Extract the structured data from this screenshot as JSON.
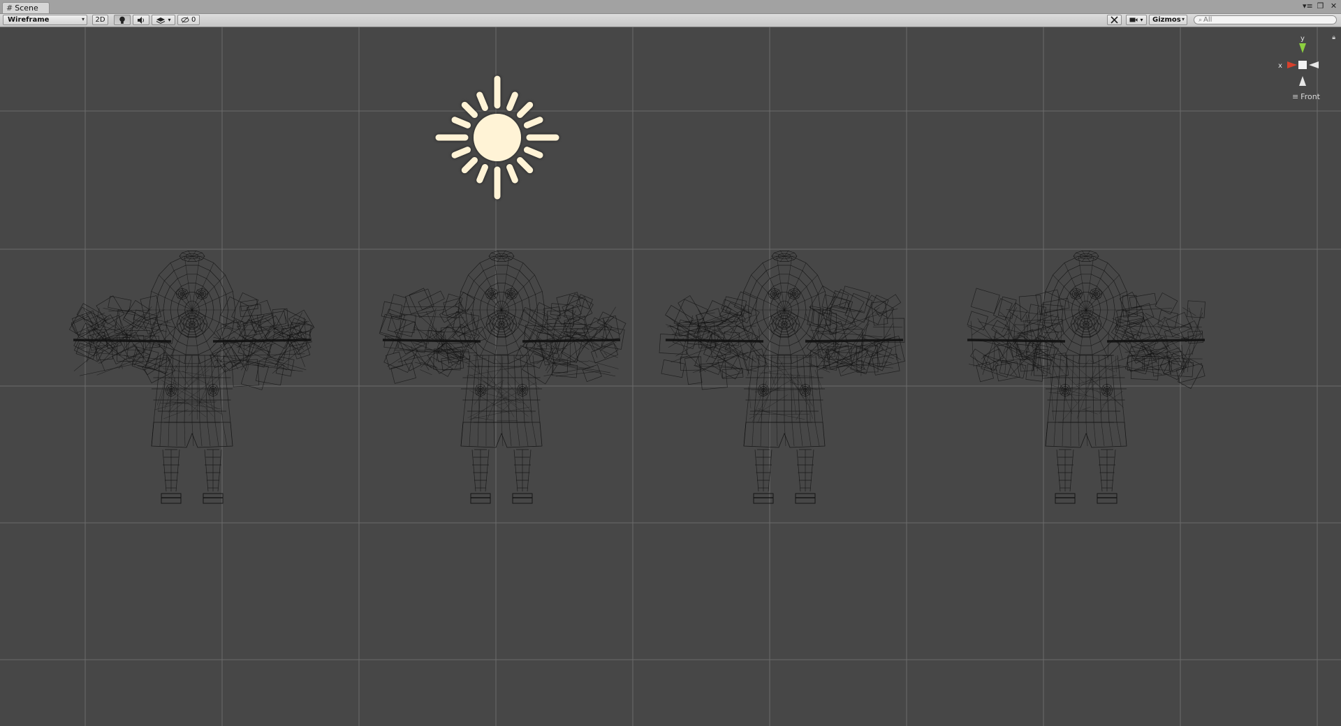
{
  "window": {
    "tab_label": "Scene",
    "tab_icon": "grid-icon",
    "controls": [
      "minimize-icon",
      "maximize-icon",
      "close-icon"
    ]
  },
  "toolbar": {
    "draw_mode": "Wireframe",
    "mode_2d": "2D",
    "lighting_icon": "lightbulb-icon",
    "audio_icon": "speaker-icon",
    "effects_icon": "layers-icon",
    "hidden_count": "0",
    "tools_icon": "tools-icon",
    "camera_icon": "camera-icon",
    "gizmos_label": "Gizmos",
    "search_placeholder": "All"
  },
  "scene": {
    "view_label": "Front",
    "axis_y": "y",
    "axis_x": "x",
    "colors": {
      "background": "#474747",
      "grid": "#6a6a6a",
      "sun": "#fff3d6",
      "wire": "#111111",
      "axis_x": "#d8402c",
      "axis_y": "#8ccf3f"
    },
    "models": [
      {
        "name": "character-wireframe-1"
      },
      {
        "name": "character-wireframe-2"
      },
      {
        "name": "character-wireframe-3"
      },
      {
        "name": "character-wireframe-4"
      }
    ]
  }
}
